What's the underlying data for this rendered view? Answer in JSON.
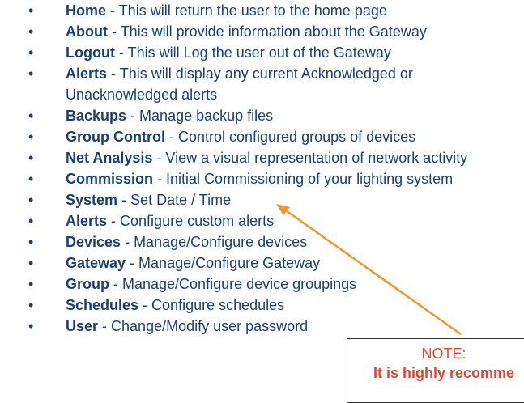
{
  "menu_items": [
    {
      "term": "Home",
      "desc": "This will return the user to the home page"
    },
    {
      "term": "About",
      "desc": "This will provide information about the Gateway"
    },
    {
      "term": "Logout",
      "desc": "This will Log the user out of the Gateway"
    },
    {
      "term": "Alerts",
      "desc": "This will display any current Acknowledged or Unacknowledged alerts"
    },
    {
      "term": "Backups",
      "desc": "Manage backup files"
    },
    {
      "term": "Group Control",
      "desc": "Control configured groups of devices"
    },
    {
      "term": "Net Analysis",
      "desc": "View a visual representation of network activity"
    },
    {
      "term": "Commission",
      "desc": "Initial Commissioning of your lighting system"
    },
    {
      "term": "System",
      "desc": "Set Date / Time"
    },
    {
      "term": "Alerts",
      "desc": "Configure custom alerts"
    },
    {
      "term": "Devices",
      "desc": "Manage/Configure devices"
    },
    {
      "term": "Gateway",
      "desc": "Manage/Configure Gateway"
    },
    {
      "term": "Group",
      "desc": "Manage/Configure device groupings"
    },
    {
      "term": "Schedules",
      "desc": "Configure schedules"
    },
    {
      "term": "User",
      "desc": "Change/Modify user password"
    }
  ],
  "separator": " - ",
  "bullet": "•",
  "note": {
    "title": "NOTE:",
    "body": "It is highly recomme"
  },
  "colors": {
    "text": "#1c3f73",
    "arrow": "#f0962e",
    "note_text": "#e5452f",
    "note_border": "#333333"
  }
}
